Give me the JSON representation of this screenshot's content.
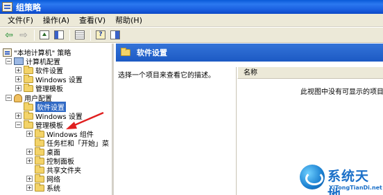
{
  "window": {
    "title": "组策略"
  },
  "menu": [
    "文件(F)",
    "操作(A)",
    "查看(V)",
    "帮助(H)"
  ],
  "tree": {
    "root": "\"本地计算机\" 策略",
    "computer": {
      "label": "计算机配置",
      "children": [
        "软件设置",
        "Windows 设置",
        "管理模板"
      ]
    },
    "user": {
      "label": "用户配置",
      "children": [
        "软件设置",
        "Windows 设置",
        "管理模板"
      ],
      "admin_children": [
        "Windows 组件",
        "任务栏和「开始」菜",
        "桌面",
        "控制面板",
        "共享文件夹",
        "网络",
        "系统"
      ]
    }
  },
  "right": {
    "header": "软件设置",
    "description": "选择一个项目来查看它的描述。",
    "column_name": "名称",
    "empty_message": "此视图中没有可显示的项目"
  },
  "watermark": {
    "cn": "系统天地",
    "en": "XiTongTianDi.net"
  },
  "colors": {
    "titlebar": "#0a5ad8",
    "selection": "#316ac5",
    "annotation": "#e02020"
  },
  "icons": [
    "back-arrow-icon",
    "forward-arrow-icon",
    "up-folder-icon",
    "show-tree-icon",
    "export-list-icon",
    "help-icon",
    "view-icon"
  ]
}
